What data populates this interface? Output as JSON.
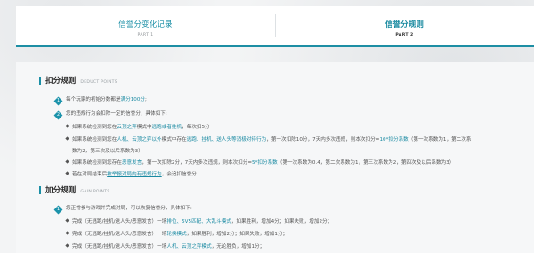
{
  "tabs": [
    {
      "title": "信誉分变化记录",
      "sub": "PART 1",
      "active": false
    },
    {
      "title": "信誉分规则",
      "sub": "PART 2",
      "active": true
    }
  ],
  "deduct": {
    "title": "扣分规则",
    "en": "DEDUCT POINTS",
    "item1": {
      "num": "1",
      "pre": "每个玩家的初始分数都是",
      "hl": "满分100分",
      "post": ";"
    },
    "item2": {
      "num": "2",
      "text": "您的违规行为会扣除一定的信誉分，具体如下:"
    },
    "b1": {
      "pre": "如果系统检测到您在",
      "hl1": "云顶之弈",
      "mid": "模式中",
      "hl2": "逃跑或者挂机",
      "post": "，每次扣5分"
    },
    "b2": {
      "pre": "如果系统检测到您在",
      "hl1": "人机、云顶之弈以外",
      "mid": "模式中存在",
      "hl2": "逃跑、挂机、送人头等消极对待行为",
      "post": "，第一次扣除10分，7天内多次违规，则本次扣分=",
      "hl3": "10*扣分系数",
      "post2": "（第一次系数为1，第二次系",
      "wrap": "数为2，第三次及以后系数为3）"
    },
    "b3": {
      "pre": "如果系统检测到您存在",
      "hl1": "恶意发言",
      "mid": "，第一次扣除2分，7天内多次违规，则本次扣分=",
      "hl2": "5*扣分系数",
      "post": "（第一次系数为0.4，第二次系数为1，第三次系数为2，第四次及以后系数为3）"
    },
    "b4": {
      "pre": "若在对局结束后",
      "hl1": "被举报对局内有违规行为",
      "post": "，会追扣信誉分"
    }
  },
  "gain": {
    "title": "加分规则",
    "en": "GAIN POINTS",
    "item1": {
      "num": "1",
      "text": "您正常参与游戏并完成对局，可以恢复信誉分，具体如下:"
    },
    "b1": {
      "pre": "完成（无逃跑/挂机/送人头/恶意发言）一场",
      "hl1": "排位、5V5匹配、大乱斗模式",
      "mid": "，如果胜利，增加4分；如果失败，增加2分；"
    },
    "b2": {
      "pre": "完成（无逃跑/挂机/送人头/恶意发言）一场",
      "hl1": "轮换模式",
      "mid": "，如果胜利，增加2分；如果失败，增加1分；"
    },
    "b3": {
      "pre": "完成（无逃跑/挂机/送人头/恶意发言）一场",
      "hl1": "人机、云顶之弈模式",
      "mid": "，无论胜负，增加1分；"
    }
  }
}
